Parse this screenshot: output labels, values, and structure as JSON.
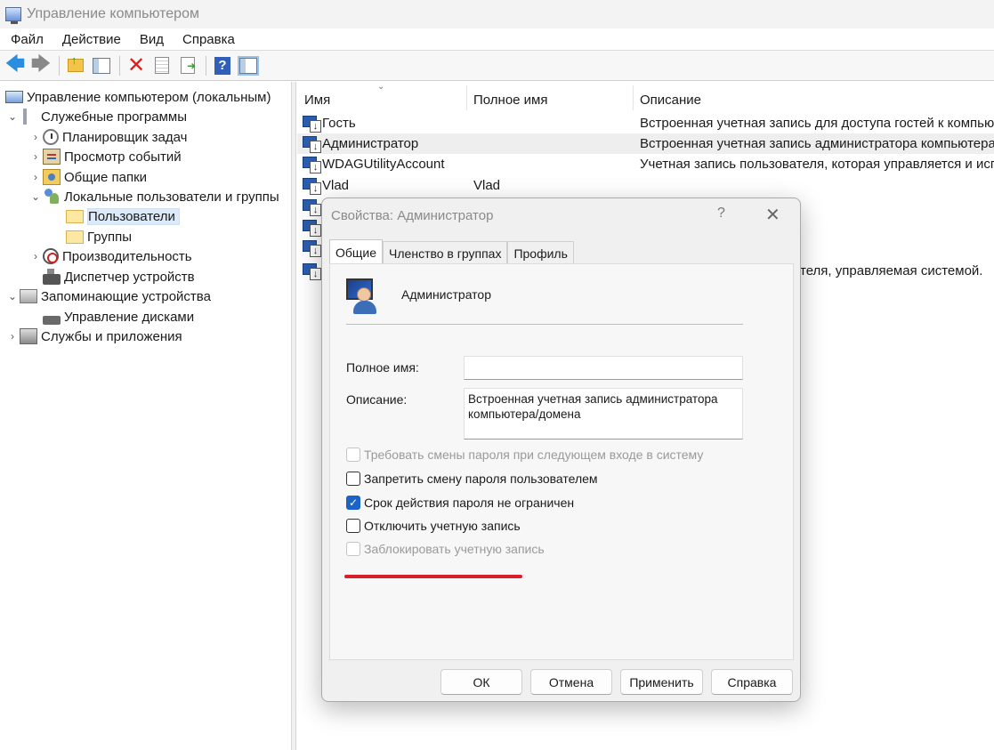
{
  "window": {
    "title": "Управление компьютером"
  },
  "menu": [
    "Файл",
    "Действие",
    "Вид",
    "Справка"
  ],
  "tree": {
    "root": "Управление компьютером (локальным)",
    "system_tools": "Служебные программы",
    "task_scheduler": "Планировщик задач",
    "event_viewer": "Просмотр событий",
    "shared_folders": "Общие папки",
    "local_users_groups": "Локальные пользователи и группы",
    "users": "Пользователи",
    "groups": "Группы",
    "performance": "Производительность",
    "device_manager": "Диспетчер устройств",
    "storage": "Запоминающие устройства",
    "disk_management": "Управление дисками",
    "services_apps": "Службы и приложения"
  },
  "list": {
    "columns": {
      "name": "Имя",
      "full_name": "Полное имя",
      "description": "Описание"
    },
    "rows": [
      {
        "name": "Гость",
        "full_name": "",
        "description": "Встроенная учетная запись для доступа гостей к компьюте"
      },
      {
        "name": "Администратор",
        "full_name": "",
        "description": "Встроенная учетная запись администратора компьютера/д"
      },
      {
        "name": "WDAGUtilityAccount",
        "full_name": "",
        "description": "Учетная запись пользователя, которая управляется и испол"
      },
      {
        "name": "Vlad",
        "full_name": "Vlad",
        "description": ""
      }
    ],
    "partial_description": "теля, управляемая системой."
  },
  "dialog": {
    "title": "Свойства: Администратор",
    "help_glyph": "?",
    "close_glyph": "✕",
    "tabs": [
      "Общие",
      "Членство в группах",
      "Профиль"
    ],
    "user_name": "Администратор",
    "full_name_label": "Полное имя:",
    "full_name_value": "",
    "description_label": "Описание:",
    "description_value": "Встроенная учетная запись администратора компьютера/домена",
    "checkboxes": [
      {
        "label": "Требовать смены пароля при следующем входе в систему",
        "checked": false,
        "disabled": true
      },
      {
        "label": "Запретить смену пароля пользователем",
        "checked": false,
        "disabled": false
      },
      {
        "label": "Срок действия пароля не ограничен",
        "checked": true,
        "disabled": false
      },
      {
        "label": "Отключить учетную запись",
        "checked": false,
        "disabled": false
      },
      {
        "label": "Заблокировать учетную запись",
        "checked": false,
        "disabled": true
      }
    ],
    "buttons": {
      "ok": "ОК",
      "cancel": "Отмена",
      "apply": "Применить",
      "help": "Справка"
    }
  },
  "colors": {
    "accent": "#1b63c6",
    "highlight_line": "#d8202a",
    "selection": "#dbe9f8"
  }
}
